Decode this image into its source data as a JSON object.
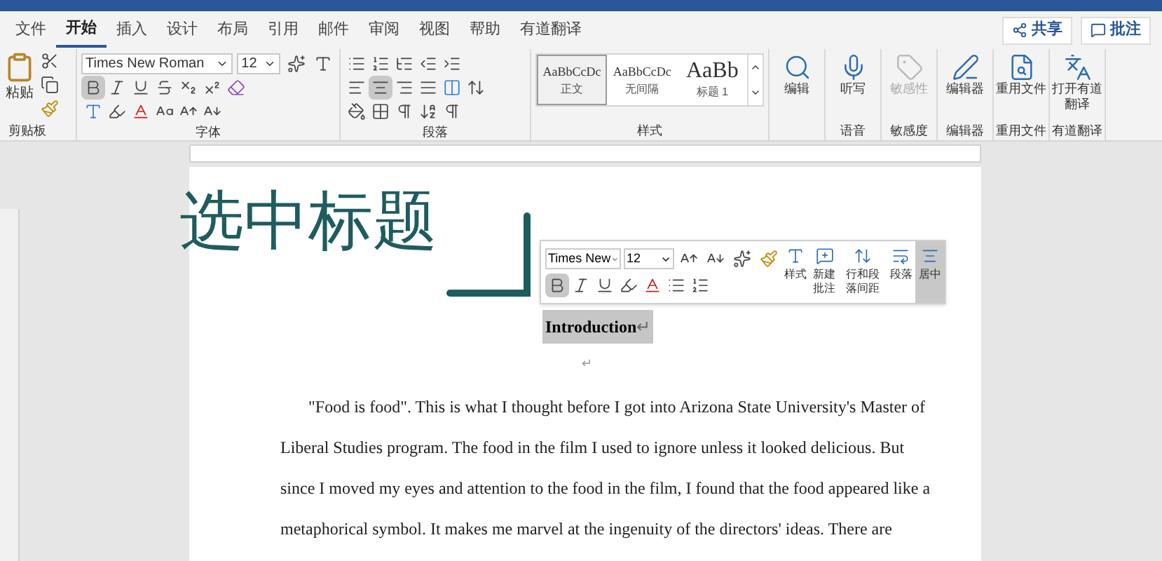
{
  "menu_tabs": [
    {
      "label": "文件",
      "selected": false
    },
    {
      "label": "开始",
      "selected": true
    },
    {
      "label": "插入",
      "selected": false
    },
    {
      "label": "设计",
      "selected": false
    },
    {
      "label": "布局",
      "selected": false
    },
    {
      "label": "引用",
      "selected": false
    },
    {
      "label": "邮件",
      "selected": false
    },
    {
      "label": "审阅",
      "selected": false
    },
    {
      "label": "视图",
      "selected": false
    },
    {
      "label": "帮助",
      "selected": false
    },
    {
      "label": "有道翻译",
      "selected": false
    }
  ],
  "share_button": "共享",
  "comments_button": "批注",
  "clipboard": {
    "paste": "粘贴",
    "group": "剪贴板"
  },
  "font": {
    "name": "Times New Roman",
    "size": "12",
    "group": "字体",
    "bold": true
  },
  "paragraph": {
    "group": "段落",
    "center": true
  },
  "styles": {
    "group": "样式",
    "items": [
      {
        "preview": "AaBbCcDc",
        "label": "正文",
        "selected": true,
        "kind": "small"
      },
      {
        "preview": "AaBbCcDc",
        "label": "无间隔",
        "selected": false,
        "kind": "small"
      },
      {
        "preview": "AaBb",
        "label": "标题 1",
        "selected": false,
        "kind": "large"
      }
    ]
  },
  "big_buttons": [
    {
      "label": "编辑",
      "kind": "search",
      "disabled": false
    },
    {
      "label": "听写",
      "group": "语音",
      "kind": "mic",
      "disabled": false
    },
    {
      "label": "敏感性",
      "group": "敏感度",
      "kind": "tag",
      "disabled": true
    },
    {
      "label": "编辑器",
      "group": "编辑器",
      "kind": "pen",
      "disabled": false
    },
    {
      "label": "重用文件",
      "group": "重用文件",
      "kind": "file",
      "disabled": false
    },
    {
      "label": "打开有道翻译",
      "group": "有道翻译",
      "kind": "translate",
      "disabled": false
    }
  ],
  "overlay_caption": "选中标题",
  "mini_toolbar": {
    "font_name": "Times New",
    "font_size": "12",
    "bold": true,
    "buttons": [
      {
        "label": "样式",
        "kind": "styles",
        "selected": false
      },
      {
        "label": "新建批注",
        "kind": "comment",
        "selected": false
      },
      {
        "label": "行和段落间距",
        "kind": "spacing",
        "selected": false
      },
      {
        "label": "段落",
        "kind": "paragraph",
        "selected": false
      },
      {
        "label": "居中",
        "kind": "center",
        "selected": true
      }
    ]
  },
  "document": {
    "heading": "Introduction",
    "heading_mark": "↵",
    "empty_mark": "↵",
    "paragraph_lines": [
      "\"Food is food\". This is what I thought before I got into Arizona State University's Master of",
      "Liberal Studies program. The food in the film I used to ignore unless it looked delicious. But",
      "since I moved my eyes and attention to the food in the film, I found that the food appeared like a",
      "metaphorical symbol. It makes me marvel at the ingenuity of the directors' ideas. There are"
    ]
  }
}
